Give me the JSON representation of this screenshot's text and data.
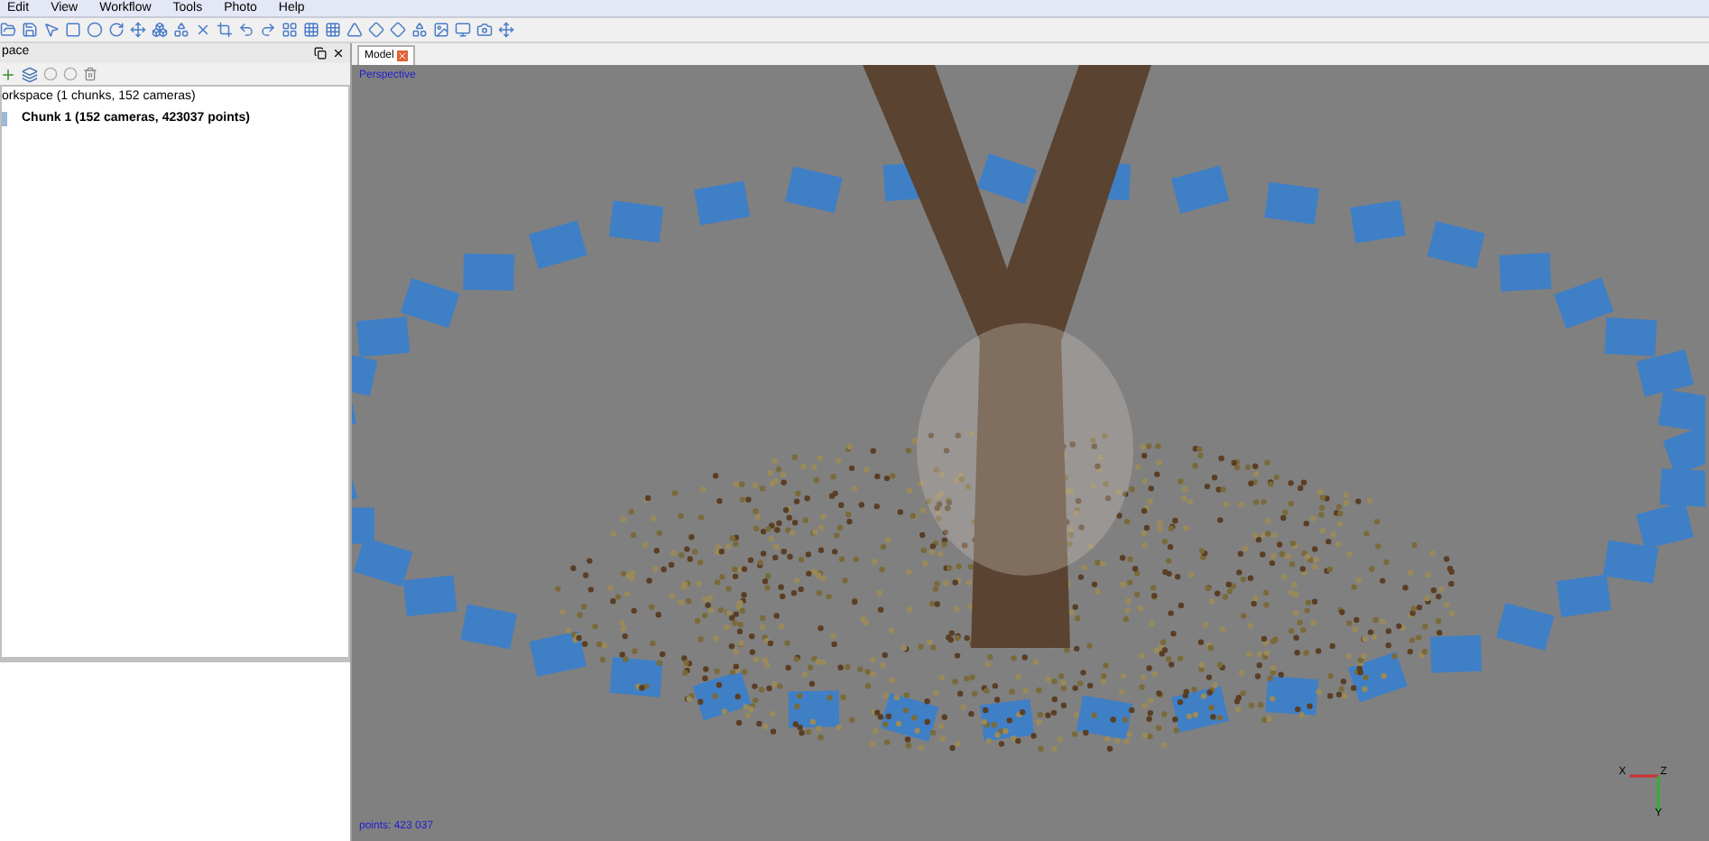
{
  "menu": [
    "Edit",
    "View",
    "Workflow",
    "Tools",
    "Photo",
    "Help"
  ],
  "workspace_panel": {
    "title": "pace",
    "tree": [
      {
        "label": "orkspace (1 chunks, 152 cameras)",
        "bold": false,
        "children": [
          {
            "label": "Chunk 1 (152 cameras, 423037 points)",
            "bold": true
          }
        ]
      }
    ]
  },
  "tabs": [
    {
      "label": "Model",
      "selected": true
    }
  ],
  "viewport": {
    "projection": "Perspective",
    "points": "points: 423 037",
    "axes": [
      "X",
      "Z",
      "Y"
    ]
  }
}
